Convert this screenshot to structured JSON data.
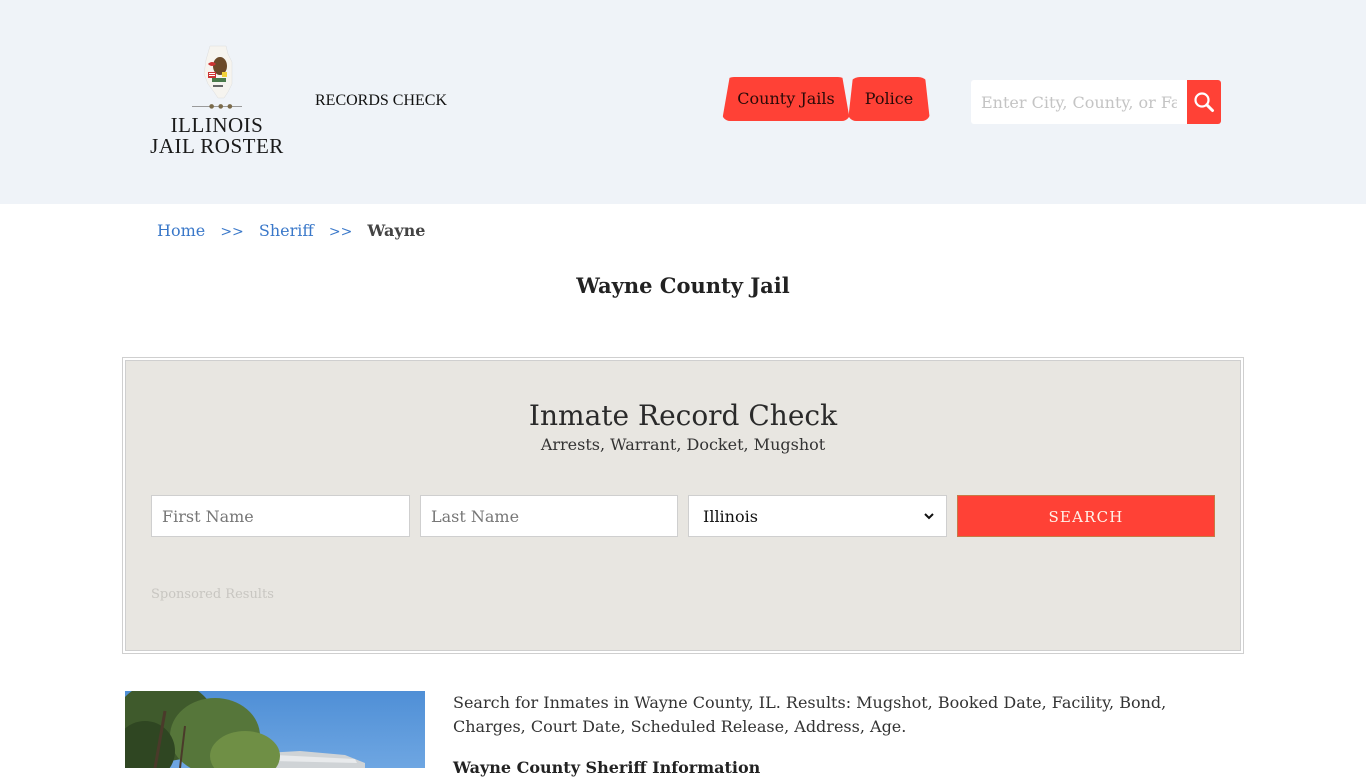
{
  "header": {
    "logo": {
      "line1": "ILLINOIS",
      "line2": "JAIL ROSTER",
      "dots": "● ● ●",
      "emblem_icon": "illinois-state-seal-icon"
    },
    "records_check_label": "RECORDS CHECK",
    "nav": [
      {
        "label": "County Jails"
      },
      {
        "label": "Police"
      }
    ],
    "search": {
      "placeholder": "Enter City, County, or Facility",
      "button_icon": "search-icon"
    }
  },
  "breadcrumb": {
    "items": [
      {
        "label": "Home"
      },
      {
        "label": "Sheriff"
      },
      {
        "label": "Wayne"
      }
    ],
    "separator": ">>"
  },
  "page_title": "Wayne County Jail",
  "record_check": {
    "title": "Inmate Record Check",
    "subtitle": "Arrests, Warrant, Docket, Mugshot",
    "first_name_placeholder": "First Name",
    "last_name_placeholder": "Last Name",
    "state_selected": "Illinois",
    "search_label": "SEARCH",
    "sponsored_label": "Sponsored Results"
  },
  "content": {
    "description": "Search for Inmates in Wayne County, IL. Results: Mugshot, Booked Date, Facility, Bond, Charges, Court Date, Scheduled Release, Address, Age.",
    "subheading": "Wayne County Sheriff Information"
  },
  "colors": {
    "accent": "#ff4136",
    "header_bg": "#eff3f8",
    "link": "#3a78c9",
    "panel_bg": "#e8e6e1"
  }
}
